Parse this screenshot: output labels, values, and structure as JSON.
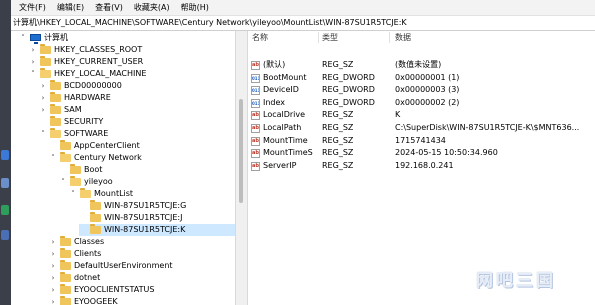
{
  "menu": [
    "文件(F)",
    "编辑(E)",
    "查看(V)",
    "收藏夹(A)",
    "帮助(H)"
  ],
  "address": "计算机\\HKEY_LOCAL_MACHINE\\SOFTWARE\\Century Network\\yileyoo\\MountList\\WIN-87SU1R5TCJE:K",
  "tree": [
    {
      "label": "计算机",
      "chevron": "˅",
      "icon": "computer-icon"
    },
    {
      "label": "HKEY_CLASSES_ROOT",
      "chevron": "›",
      "icon": "folder-icon"
    },
    {
      "label": "HKEY_CURRENT_USER",
      "chevron": "›",
      "icon": "folder-icon"
    },
    {
      "label": "HKEY_LOCAL_MACHINE",
      "chevron": "˅",
      "icon": "folder-open-icon"
    },
    {
      "label": "BCD00000000",
      "chevron": "›",
      "icon": "folder-icon"
    },
    {
      "label": "HARDWARE",
      "chevron": "›",
      "icon": "folder-icon"
    },
    {
      "label": "SAM",
      "chevron": "›",
      "icon": "folder-icon"
    },
    {
      "label": "SECURITY",
      "chevron": "",
      "icon": "folder-icon"
    },
    {
      "label": "SOFTWARE",
      "chevron": "˅",
      "icon": "folder-open-icon"
    },
    {
      "label": "AppCenterClient",
      "chevron": "",
      "icon": "folder-icon"
    },
    {
      "label": "Century Network",
      "chevron": "˅",
      "icon": "folder-open-icon"
    },
    {
      "label": "Boot",
      "chevron": "",
      "icon": "folder-icon"
    },
    {
      "label": "yileyoo",
      "chevron": "˅",
      "icon": "folder-open-icon"
    },
    {
      "label": "MountList",
      "chevron": "˅",
      "icon": "folder-open-icon"
    },
    {
      "label": "WIN-87SU1R5TCJE:G",
      "chevron": "",
      "icon": "folder-icon"
    },
    {
      "label": "WIN-87SU1R5TCJE:J",
      "chevron": "",
      "icon": "folder-icon"
    },
    {
      "label": "WIN-87SU1R5TCJE:K",
      "chevron": "",
      "icon": "folder-icon",
      "selected": true
    },
    {
      "label": "Classes",
      "chevron": "›",
      "icon": "folder-icon"
    },
    {
      "label": "Clients",
      "chevron": "›",
      "icon": "folder-icon"
    },
    {
      "label": "DefaultUserEnvironment",
      "chevron": "›",
      "icon": "folder-icon"
    },
    {
      "label": "dotnet",
      "chevron": "›",
      "icon": "folder-icon"
    },
    {
      "label": "EYOOCLIENTSTATUS",
      "chevron": "›",
      "icon": "folder-icon"
    },
    {
      "label": "EYOOGEEK",
      "chevron": "›",
      "icon": "folder-icon"
    }
  ],
  "list": {
    "headers": {
      "name": "名称",
      "type": "类型",
      "data": "数据"
    },
    "rows": [
      {
        "name": "(默认)",
        "type": "REG_SZ",
        "data": "(数值未设置)",
        "icon": "string-value-icon",
        "icon_text": "ab"
      },
      {
        "name": "BootMount",
        "type": "REG_DWORD",
        "data": "0x00000001 (1)",
        "icon": "dword-value-icon",
        "icon_text": "011"
      },
      {
        "name": "DeviceID",
        "type": "REG_DWORD",
        "data": "0x00000003 (3)",
        "icon": "dword-value-icon",
        "icon_text": "011"
      },
      {
        "name": "Index",
        "type": "REG_DWORD",
        "data": "0x00000002 (2)",
        "icon": "dword-value-icon",
        "icon_text": "011"
      },
      {
        "name": "LocalDrive",
        "type": "REG_SZ",
        "data": "K",
        "icon": "string-value-icon",
        "icon_text": "ab"
      },
      {
        "name": "LocalPath",
        "type": "REG_SZ",
        "data": "C:\\SuperDisk\\WIN-87SU1R5TCJE-K\\$MNT636...",
        "icon": "string-value-icon",
        "icon_text": "ab"
      },
      {
        "name": "MountTime",
        "type": "REG_SZ",
        "data": "1715741434",
        "icon": "string-value-icon",
        "icon_text": "ab"
      },
      {
        "name": "MountTimeS",
        "type": "REG_SZ",
        "data": "2024-05-15 10:50:34.960",
        "icon": "string-value-icon",
        "icon_text": "ab"
      },
      {
        "name": "ServerIP",
        "type": "REG_SZ",
        "data": "192.168.0.241",
        "icon": "string-value-icon",
        "icon_text": "ab"
      }
    ]
  },
  "watermark": "网吧三国"
}
